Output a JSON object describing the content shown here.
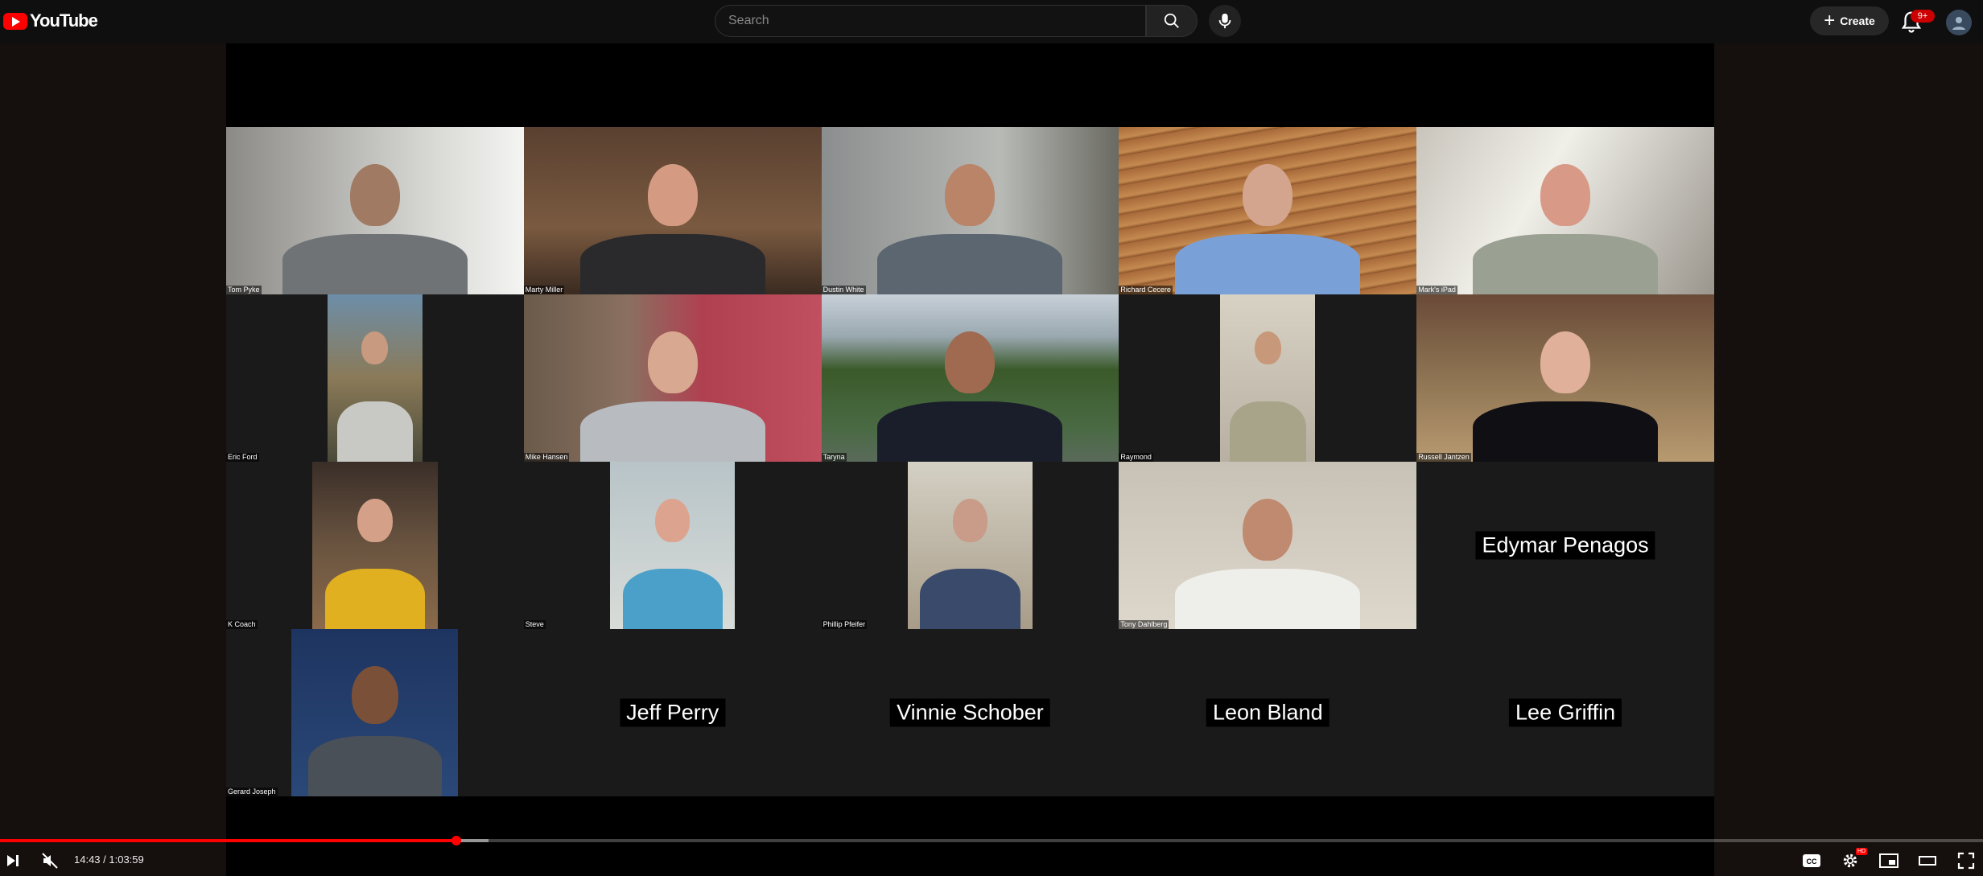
{
  "header": {
    "logo_text": "YouTube",
    "search_placeholder": "Search",
    "create_label": "Create",
    "notification_count": "9+"
  },
  "participants": [
    {
      "name": "Tom Pyke",
      "type": "video"
    },
    {
      "name": "Marty Miller",
      "type": "video"
    },
    {
      "name": "Dustin White",
      "type": "video"
    },
    {
      "name": "Richard Cecere",
      "type": "video"
    },
    {
      "name": "Mark's iPad",
      "type": "video"
    },
    {
      "name": "Eric Ford",
      "type": "video"
    },
    {
      "name": "Mike Hansen",
      "type": "video"
    },
    {
      "name": "Taryna",
      "type": "video"
    },
    {
      "name": "Raymond",
      "type": "video"
    },
    {
      "name": "Russell Jantzen",
      "type": "video"
    },
    {
      "name": "K Coach",
      "type": "video"
    },
    {
      "name": "Steve",
      "type": "video"
    },
    {
      "name": "Phillip Pfeifer",
      "type": "video"
    },
    {
      "name": "Tony Dahlberg",
      "type": "video"
    },
    {
      "name": "Edymar Penagos",
      "type": "name-only"
    },
    {
      "name": "Gerard Joseph",
      "type": "video"
    },
    {
      "name": "Jeff Perry",
      "type": "name-only"
    },
    {
      "name": "Vinnie Schober",
      "type": "name-only"
    },
    {
      "name": "Leon Bland",
      "type": "name-only"
    },
    {
      "name": "Lee Griffin",
      "type": "name-only"
    }
  ],
  "player": {
    "time_display": "14:43 / 1:03:59",
    "progress_fraction": 0.23,
    "buffered_fraction": 0.2297,
    "settings_badge": "HD",
    "accent_color": "#ff0000"
  }
}
